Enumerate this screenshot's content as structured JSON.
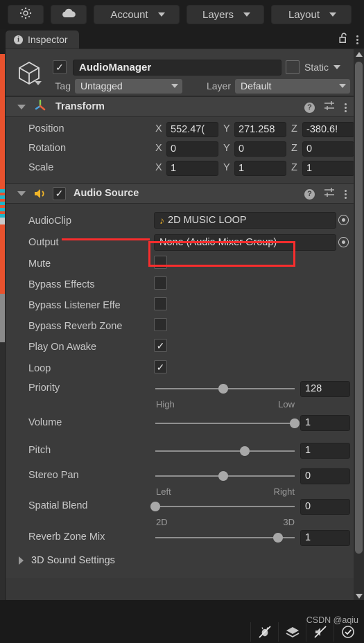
{
  "toolbar": {
    "buttons": [
      {
        "name": "gizmo-icon",
        "label": ""
      },
      {
        "name": "cloud-icon",
        "label": ""
      }
    ],
    "dropdowns": [
      {
        "label": "Account"
      },
      {
        "label": "Layers"
      },
      {
        "label": "Layout"
      }
    ]
  },
  "tab": {
    "label": "Inspector",
    "icon": "info-icon",
    "lock_icon": "unlocked-padlock-icon",
    "menu_icon": "kebab-menu-icon"
  },
  "gameobject": {
    "enabled": true,
    "name": "AudioManager",
    "static_label": "Static",
    "static_checked": false,
    "tag_label": "Tag",
    "tag_value": "Untagged",
    "layer_label": "Layer",
    "layer_value": "Default"
  },
  "transform": {
    "title": "Transform",
    "expanded": true,
    "rows": [
      {
        "label": "Position",
        "x": "552.47(",
        "y": "271.258",
        "z": "-380.6!"
      },
      {
        "label": "Rotation",
        "x": "0",
        "y": "0",
        "z": "0"
      },
      {
        "label": "Scale",
        "x": "1",
        "y": "1",
        "z": "1"
      }
    ],
    "axes": [
      "X",
      "Y",
      "Z"
    ]
  },
  "audio_source": {
    "title": "Audio Source",
    "enabled": true,
    "expanded": true,
    "object_fields": [
      {
        "label": "AudioClip",
        "value": "2D MUSIC LOOP",
        "icon": "audio-clip-note-icon",
        "highlighted": true
      },
      {
        "label": "Output",
        "value": "None (Audio Mixer Group)",
        "icon": "",
        "highlighted": false
      }
    ],
    "toggles": [
      {
        "label": "Mute",
        "checked": false
      },
      {
        "label": "Bypass Effects",
        "checked": false
      },
      {
        "label": "Bypass Listener Effe",
        "checked": false
      },
      {
        "label": "Bypass Reverb Zone",
        "checked": false
      },
      {
        "label": "Play On Awake",
        "checked": true
      },
      {
        "label": "Loop",
        "checked": true
      }
    ],
    "sliders": [
      {
        "label": "Priority",
        "value": "128",
        "percent": 49,
        "left_cap": "High",
        "right_cap": "Low"
      },
      {
        "label": "Volume",
        "value": "1",
        "percent": 100,
        "left_cap": "",
        "right_cap": ""
      },
      {
        "label": "Pitch",
        "value": "1",
        "percent": 64,
        "left_cap": "",
        "right_cap": ""
      },
      {
        "label": "Stereo Pan",
        "value": "0",
        "percent": 49,
        "left_cap": "Left",
        "right_cap": "Right"
      },
      {
        "label": "Spatial Blend",
        "value": "0",
        "percent": 0,
        "left_cap": "2D",
        "right_cap": "3D"
      },
      {
        "label": "Reverb Zone Mix",
        "value": "1",
        "percent": 88,
        "left_cap": "",
        "right_cap": ""
      }
    ],
    "sub_foldout": {
      "label": "3D Sound Settings",
      "expanded": false
    }
  },
  "statusbar": {
    "watermark": "CSDN @aqiu",
    "icons": [
      "bug-off-icon",
      "layers-icon",
      "no-sound-icon",
      "check-circle-icon"
    ]
  },
  "colors": {
    "accent_red": "#f72d2d",
    "panel": "#383838",
    "header": "#414141",
    "field": "#282828",
    "speaker_icon": "#f0b428"
  }
}
